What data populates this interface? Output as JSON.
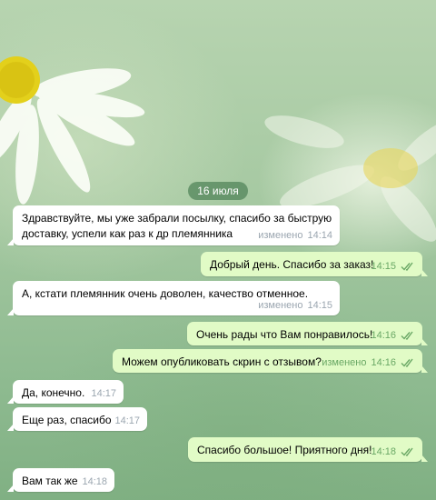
{
  "chat": {
    "date_label": "16 июля",
    "edited_label": "изменено",
    "messages": [
      {
        "dir": "in",
        "lines": [
          "Здравствуйте, мы уже забрали посылку, спасибо за быструю",
          "доставку, успели как раз к др племянника"
        ],
        "time": "14:14",
        "edited": true
      },
      {
        "dir": "out",
        "lines": [
          "Добрый день. Спасибо за заказ!"
        ],
        "time": "14:15",
        "edited": false,
        "read": true
      },
      {
        "dir": "in",
        "lines": [
          "А, кстати племянник очень доволен, качество отменное."
        ],
        "time": "14:15",
        "edited": true
      },
      {
        "dir": "out",
        "lines": [
          "Очень рады что Вам понравилось!"
        ],
        "time": "14:16",
        "edited": false,
        "read": true
      },
      {
        "dir": "out",
        "lines": [
          "Можем опубликовать скрин с отзывом?"
        ],
        "time": "14:16",
        "edited": true,
        "read": true
      },
      {
        "dir": "in",
        "lines": [
          "Да, конечно."
        ],
        "time": "14:17",
        "edited": false
      },
      {
        "dir": "in",
        "lines": [
          "Еще раз, спасибо"
        ],
        "time": "14:17",
        "edited": false
      },
      {
        "dir": "out",
        "lines": [
          "Спасибо большое! Приятного дня!"
        ],
        "time": "14:18",
        "edited": false,
        "read": true
      },
      {
        "dir": "in",
        "lines": [
          "Вам так же"
        ],
        "time": "14:18",
        "edited": false
      }
    ]
  },
  "icons": {
    "read_status": "double-check-icon"
  },
  "colors": {
    "incoming_bubble": "#ffffff",
    "outgoing_bubble": "#e1fbc6",
    "timestamp_out": "#6aa865",
    "timestamp_in": "#9ba6b0",
    "date_pill": "#52845a"
  }
}
